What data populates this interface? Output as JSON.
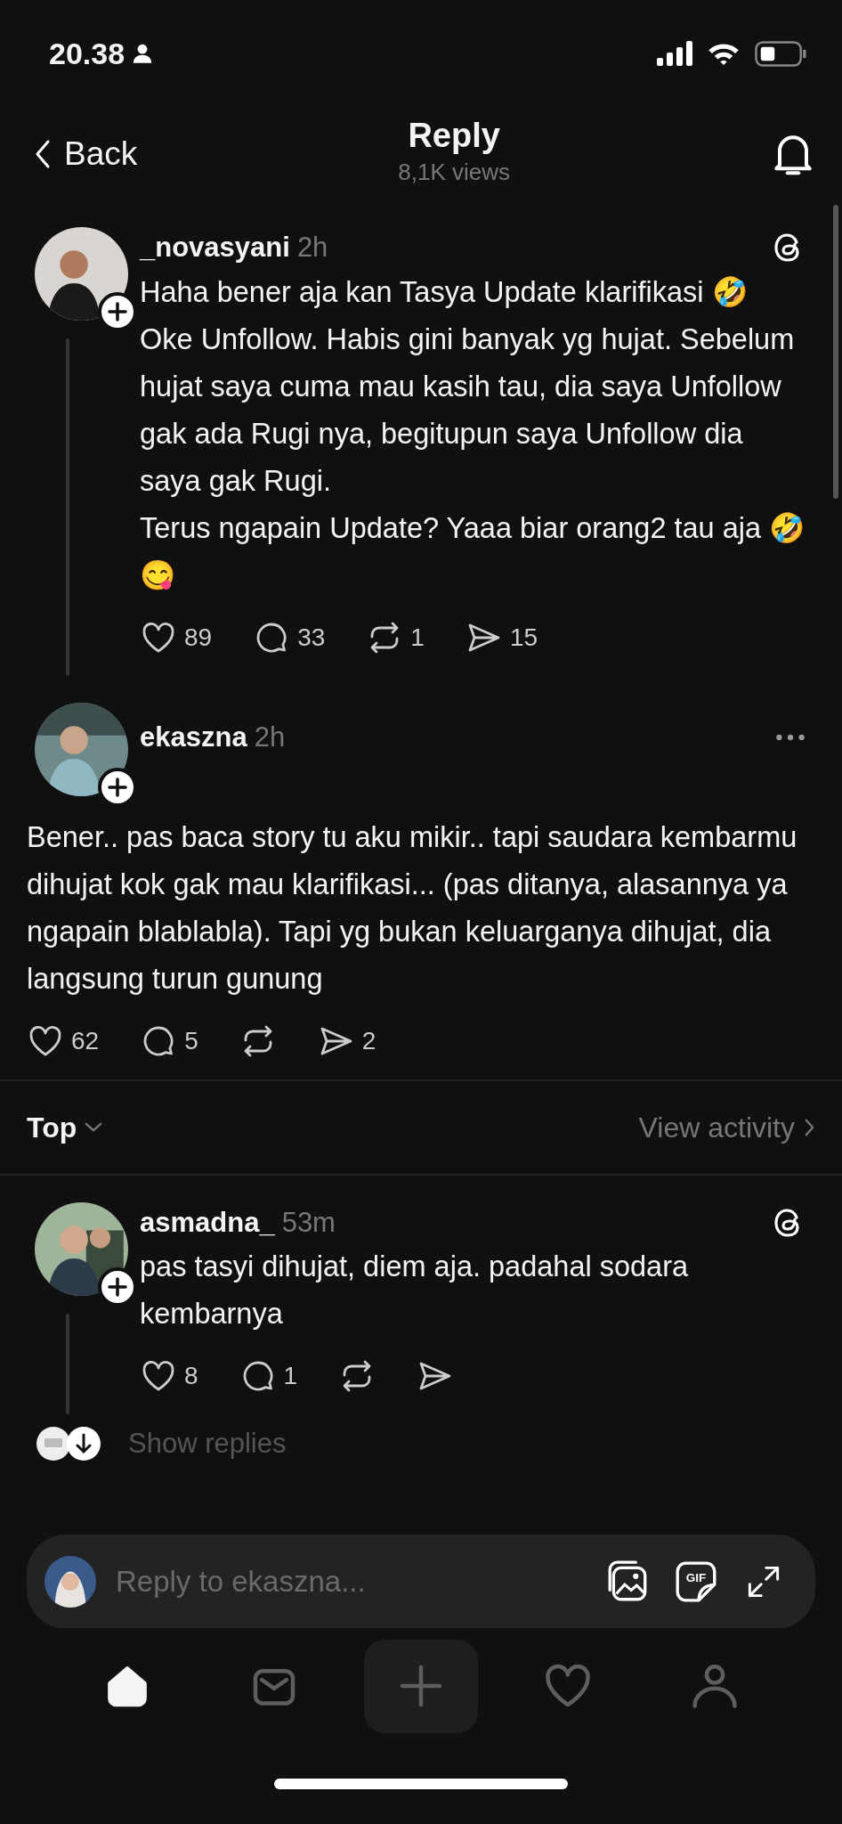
{
  "status_bar": {
    "time": "20.38"
  },
  "header": {
    "back_label": "Back",
    "title": "Reply",
    "subtitle": "8,1K views"
  },
  "posts": [
    {
      "kind": "thread",
      "username": "_novasyani",
      "time": "2h",
      "corner": {
        "kind": "logo"
      },
      "paragraphs": [
        "Haha bener aja kan Tasya Update klarifikasi 🤣 Oke Unfollow. Habis gini banyak yg hujat. Sebelum hujat saya cuma mau kasih tau, dia saya Unfollow gak ada Rugi nya, begitupun saya Unfollow dia saya gak Rugi.",
        "Terus ngapain Update? Yaaa biar orang2 tau aja 🤣 😋"
      ],
      "stats": [
        {
          "kind": "like",
          "count": "89"
        },
        {
          "kind": "reply",
          "count": "33"
        },
        {
          "kind": "repost",
          "count": "1"
        },
        {
          "kind": "share",
          "count": "15"
        }
      ]
    },
    {
      "kind": "focus",
      "username": "ekaszna",
      "time": "2h",
      "corner": {
        "kind": "more"
      },
      "paragraphs": [
        "Bener.. pas baca story tu aku mikir.. tapi saudara kembarmu dihujat kok gak mau klarifikasi... (pas ditanya, alasannya ya ngapain blablabla). Tapi yg bukan keluarganya dihujat, dia langsung turun gunung"
      ],
      "stats": [
        {
          "kind": "like",
          "count": "62"
        },
        {
          "kind": "reply",
          "count": "5"
        },
        {
          "kind": "repost"
        },
        {
          "kind": "share",
          "count": "2"
        }
      ]
    }
  ],
  "sort": {
    "label": "Top",
    "link": "View activity"
  },
  "replies": [
    {
      "kind": "thread",
      "username": "asmadna_",
      "time": "53m",
      "corner": {
        "kind": "logo"
      },
      "paragraphs": [
        "pas tasyi dihujat, diem aja. padahal sodara kembarnya"
      ],
      "stats": [
        {
          "kind": "like",
          "count": "8"
        },
        {
          "kind": "reply",
          "count": "1"
        },
        {
          "kind": "repost"
        },
        {
          "kind": "share"
        }
      ]
    }
  ],
  "show_replies": "Show replies",
  "composer": {
    "placeholder": "Reply to ekaszna...",
    "gif_label": "GIF"
  },
  "tab_bar": [
    {
      "kind": "home",
      "selected": true
    },
    {
      "kind": "inbox",
      "selected": false
    },
    {
      "kind": "create",
      "selected": false
    },
    {
      "kind": "activity",
      "selected": false
    },
    {
      "kind": "profile",
      "selected": false
    }
  ]
}
